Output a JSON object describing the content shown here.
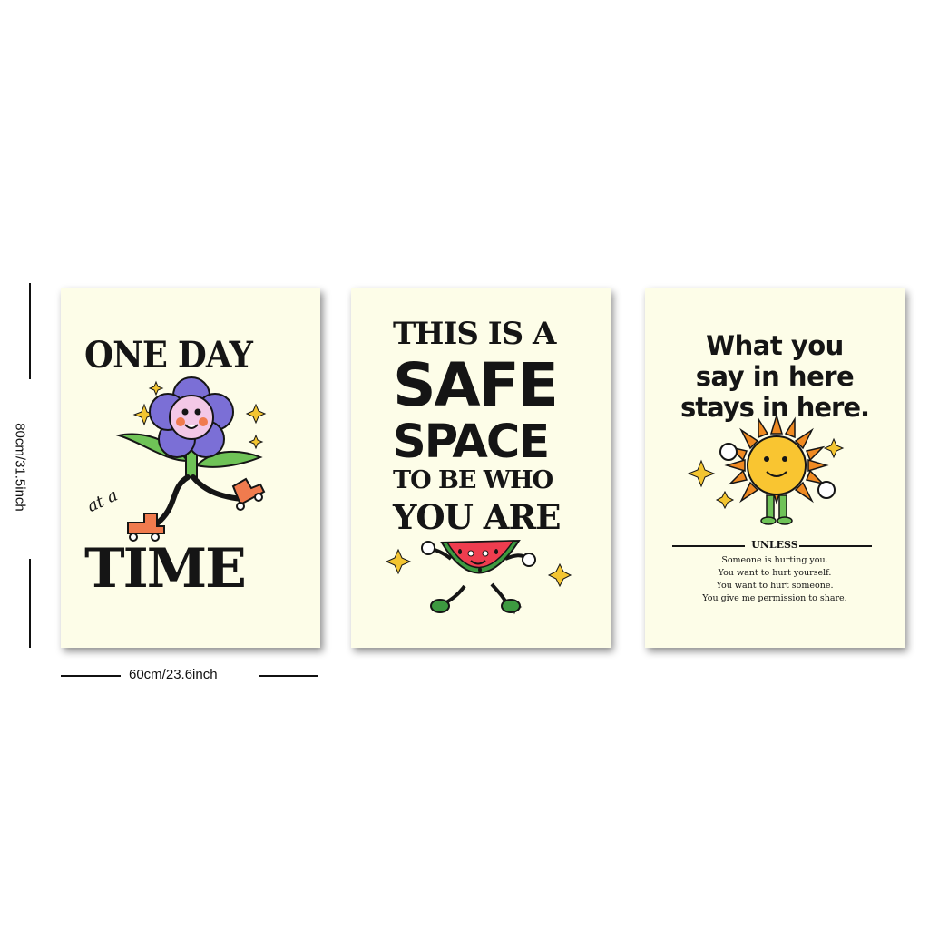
{
  "dimensions": {
    "height_label": "80cm/31.5inch",
    "width_label": "60cm/23.6inch"
  },
  "posters": [
    {
      "background": "#fdfde8",
      "line_1": "ONE DAY",
      "line_2": "at a",
      "line_3": "TIME",
      "illustration": "roller-skating-flower"
    },
    {
      "background": "#fdfde8",
      "line_1": "THIS IS A",
      "line_2": "SAFE",
      "line_3": "SPACE",
      "line_4": "TO BE WHO",
      "line_5": "YOU ARE",
      "illustration": "walking-watermelon"
    },
    {
      "background": "#fdfde8",
      "line_1": "What you",
      "line_2": "say in here",
      "line_3": "stays in here.",
      "illustration": "smiling-sun",
      "divider_label": "UNLESS",
      "conditions": [
        "Someone is hurting you.",
        "You want to hurt yourself.",
        "You want to hurt someone.",
        "You give me permission to share."
      ]
    }
  ],
  "colors": {
    "ink": "#151515",
    "flower_petal": "#7b6fd6",
    "flower_face": "#f3c8e6",
    "leaf": "#6fc357",
    "skate": "#f07b4e",
    "sparkle": "#f3c531",
    "melon_rind": "#3d9a40",
    "melon_flesh": "#ee3d4f",
    "sun_ray": "#ef8a22",
    "sun_face": "#f9c531"
  }
}
